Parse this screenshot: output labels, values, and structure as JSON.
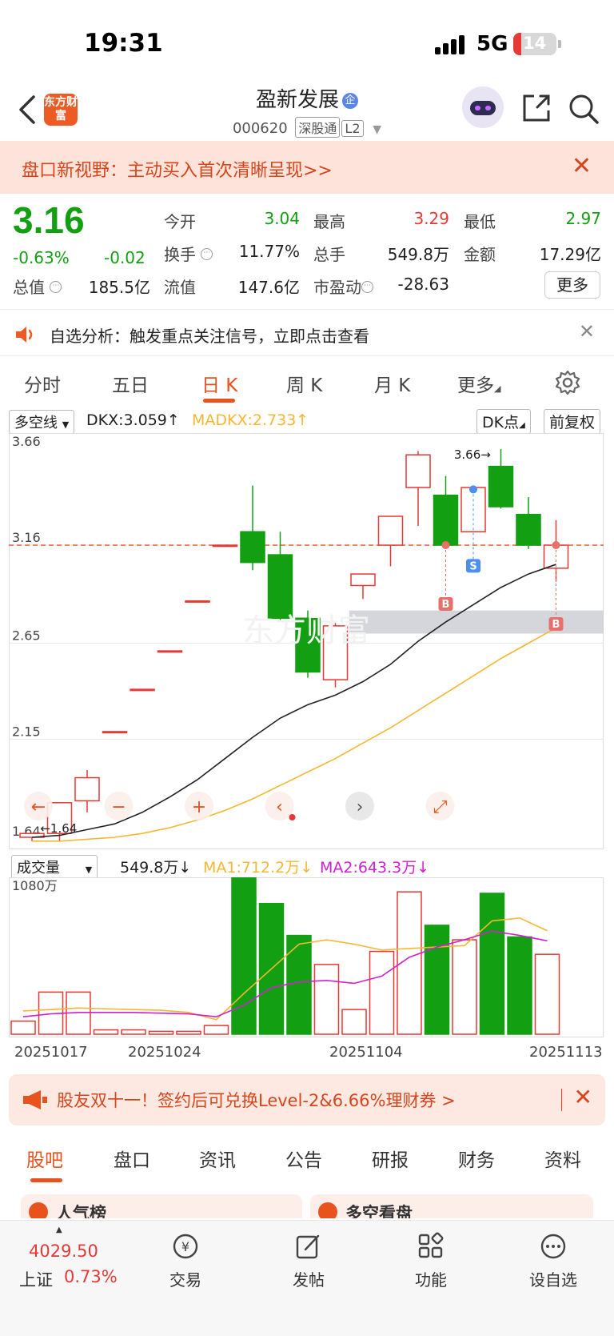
{
  "status_bar": {
    "time": "19:31",
    "network": "5G",
    "battery": "14"
  },
  "header": {
    "logo_text": "东方财富",
    "stock_name": "盈新发展",
    "badge": "企",
    "stock_code": "000620",
    "tag_market": "深股通",
    "tag_level": "L2"
  },
  "promo_banner": {
    "text": "盘口新视野：主动买入首次清晰呈现>>"
  },
  "quote": {
    "price": "3.16",
    "change_pct": "-0.63%",
    "change": "-0.02",
    "open_label": "今开",
    "open": "3.04",
    "high_label": "最高",
    "high": "3.29",
    "low_label": "最低",
    "low": "2.97",
    "turnover_label": "换手",
    "turnover": "11.77%",
    "volume_label": "总手",
    "volume": "549.8万",
    "amount_label": "金额",
    "amount": "17.29亿",
    "mktcap_label": "总值",
    "mktcap": "185.5亿",
    "float_label": "流值",
    "float": "147.6亿",
    "pe_label": "市盈动",
    "pe": "-28.63",
    "more_label": "更多",
    "colors": {
      "up": "#e53935",
      "down": "#12a012"
    }
  },
  "analysis_bar": {
    "text": "自选分析：触发重点关注信号，立即点击查看"
  },
  "period_tabs": [
    "分时",
    "五日",
    "日 K",
    "周 K",
    "月 K",
    "更多"
  ],
  "active_period": "日 K",
  "indicator_bar": {
    "selector": "多空线",
    "dkx": "DKX:3.059",
    "madkx": "MADKX:2.733",
    "dk_point": "DK点",
    "adjust": "前复权"
  },
  "chart_data": {
    "type": "candlestick",
    "y_ticks": [
      "3.66",
      "3.16",
      "2.65",
      "2.15",
      "1.64"
    ],
    "ylim": [
      1.64,
      3.66
    ],
    "last_price_line": 3.16,
    "max_label": "3.66→",
    "min_label": "←1.64",
    "markers": [
      "B",
      "S",
      "B"
    ],
    "candles": [
      {
        "o": 1.64,
        "h": 1.66,
        "l": 1.62,
        "c": 1.66
      },
      {
        "o": 1.66,
        "h": 1.82,
        "l": 1.62,
        "c": 1.82
      },
      {
        "o": 1.83,
        "h": 1.99,
        "l": 1.77,
        "c": 1.95
      },
      {
        "o": 2.19,
        "h": 2.19,
        "l": 2.19,
        "c": 2.19
      },
      {
        "o": 2.41,
        "h": 2.41,
        "l": 2.41,
        "c": 2.41
      },
      {
        "o": 2.61,
        "h": 2.61,
        "l": 2.61,
        "c": 2.61
      },
      {
        "o": 2.87,
        "h": 2.87,
        "l": 2.87,
        "c": 2.87
      },
      {
        "o": 3.16,
        "h": 3.16,
        "l": 3.16,
        "c": 3.16
      },
      {
        "o": 3.23,
        "h": 3.47,
        "l": 3.03,
        "c": 3.07
      },
      {
        "o": 3.11,
        "h": 3.23,
        "l": 2.76,
        "c": 2.78
      },
      {
        "o": 2.78,
        "h": 2.82,
        "l": 2.47,
        "c": 2.5
      },
      {
        "o": 2.46,
        "h": 2.76,
        "l": 2.42,
        "c": 2.74
      },
      {
        "o": 2.95,
        "h": 3.01,
        "l": 2.88,
        "c": 3.01
      },
      {
        "o": 3.16,
        "h": 3.31,
        "l": 3.05,
        "c": 3.31
      },
      {
        "o": 3.46,
        "h": 3.65,
        "l": 3.26,
        "c": 3.63
      },
      {
        "o": 3.42,
        "h": 3.52,
        "l": 3.16,
        "c": 3.16
      },
      {
        "o": 3.23,
        "h": 3.46,
        "l": 3.23,
        "c": 3.46
      },
      {
        "o": 3.57,
        "h": 3.66,
        "l": 3.35,
        "c": 3.36
      },
      {
        "o": 3.32,
        "h": 3.41,
        "l": 3.14,
        "c": 3.16
      },
      {
        "o": 3.04,
        "h": 3.29,
        "l": 2.97,
        "c": 3.16
      }
    ],
    "dkx": [
      1.64,
      1.65,
      1.68,
      1.71,
      1.77,
      1.85,
      1.94,
      2.05,
      2.16,
      2.26,
      2.33,
      2.38,
      2.45,
      2.54,
      2.66,
      2.76,
      2.85,
      2.94,
      3.01,
      3.06
    ],
    "madkx": [
      1.62,
      1.62,
      1.63,
      1.64,
      1.66,
      1.69,
      1.73,
      1.78,
      1.84,
      1.91,
      1.98,
      2.05,
      2.13,
      2.21,
      2.3,
      2.39,
      2.48,
      2.57,
      2.65,
      2.73
    ],
    "support_band": [
      2.7,
      2.82
    ]
  },
  "volume_bar": {
    "selector": "成交量",
    "vol": "549.8万",
    "ma1": "MA1:712.2万",
    "ma2": "MA2:643.3万",
    "max_label": "1080万",
    "dates": [
      "20251017",
      "20251024",
      "20251104",
      "20251113"
    ]
  },
  "volume_data": {
    "type": "bar",
    "max": 1080,
    "bars": [
      90,
      290,
      290,
      30,
      30,
      20,
      20,
      60,
      1080,
      900,
      680,
      480,
      170,
      570,
      980,
      750,
      650,
      970,
      670,
      550
    ],
    "ma1": [
      160,
      170,
      180,
      175,
      170,
      165,
      150,
      100,
      280,
      450,
      620,
      650,
      620,
      580,
      590,
      600,
      610,
      780,
      800,
      712
    ],
    "ma2": [
      120,
      140,
      150,
      150,
      150,
      145,
      140,
      120,
      200,
      320,
      360,
      370,
      350,
      400,
      530,
      600,
      650,
      710,
      680,
      643
    ]
  },
  "promo_banner2": {
    "text": "股友双十一！签约后可兑换Level-2&6.66%理财券 >"
  },
  "bottom_tabs": [
    "股吧",
    "盘口",
    "资讯",
    "公告",
    "研报",
    "财务",
    "资料"
  ],
  "active_bottom_tab": "股吧",
  "peek_row": {
    "left": "人气榜",
    "right": "多空看盘"
  },
  "tab_bar": {
    "index_value": "4029.50",
    "index_name": "上证",
    "index_change": "0.73%",
    "items": [
      "交易",
      "发帖",
      "功能",
      "设自选"
    ]
  }
}
